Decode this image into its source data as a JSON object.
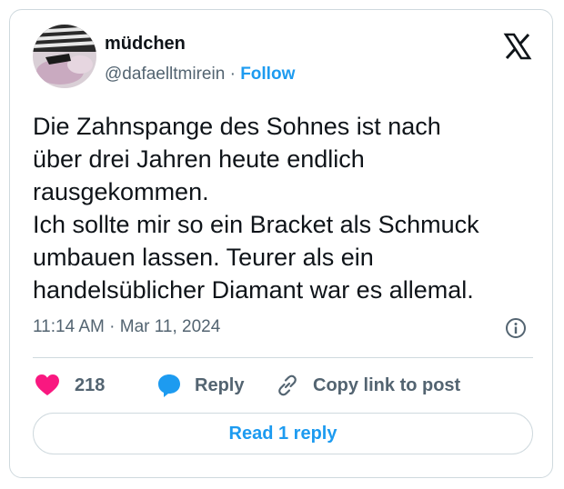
{
  "author": {
    "name": "müdchen",
    "handle": "@dafaelltmirein",
    "separator": " · ",
    "follow_label": "Follow"
  },
  "post": {
    "lines": [
      "Die Zahnspange des Sohnes ist nach",
      "über drei Jahren heute endlich",
      "rausgekommen.",
      "Ich sollte mir so ein Bracket als Schmuck",
      "umbauen lassen. Teurer als ein",
      "handelsüblicher Diamant war es allemal."
    ],
    "timestamp": "11:14 AM · Mar 11, 2024"
  },
  "actions": {
    "likes_count": "218",
    "reply_label": "Reply",
    "copy_link_label": "Copy link to post"
  },
  "read_replies_label": "Read 1 reply",
  "colors": {
    "accent": "#1d9bf0",
    "like": "#f91880",
    "text_secondary": "#536471",
    "border": "#cfd9de"
  },
  "icons": [
    "x-logo-icon",
    "info-icon",
    "heart-icon",
    "reply-bubble-icon",
    "link-icon"
  ]
}
